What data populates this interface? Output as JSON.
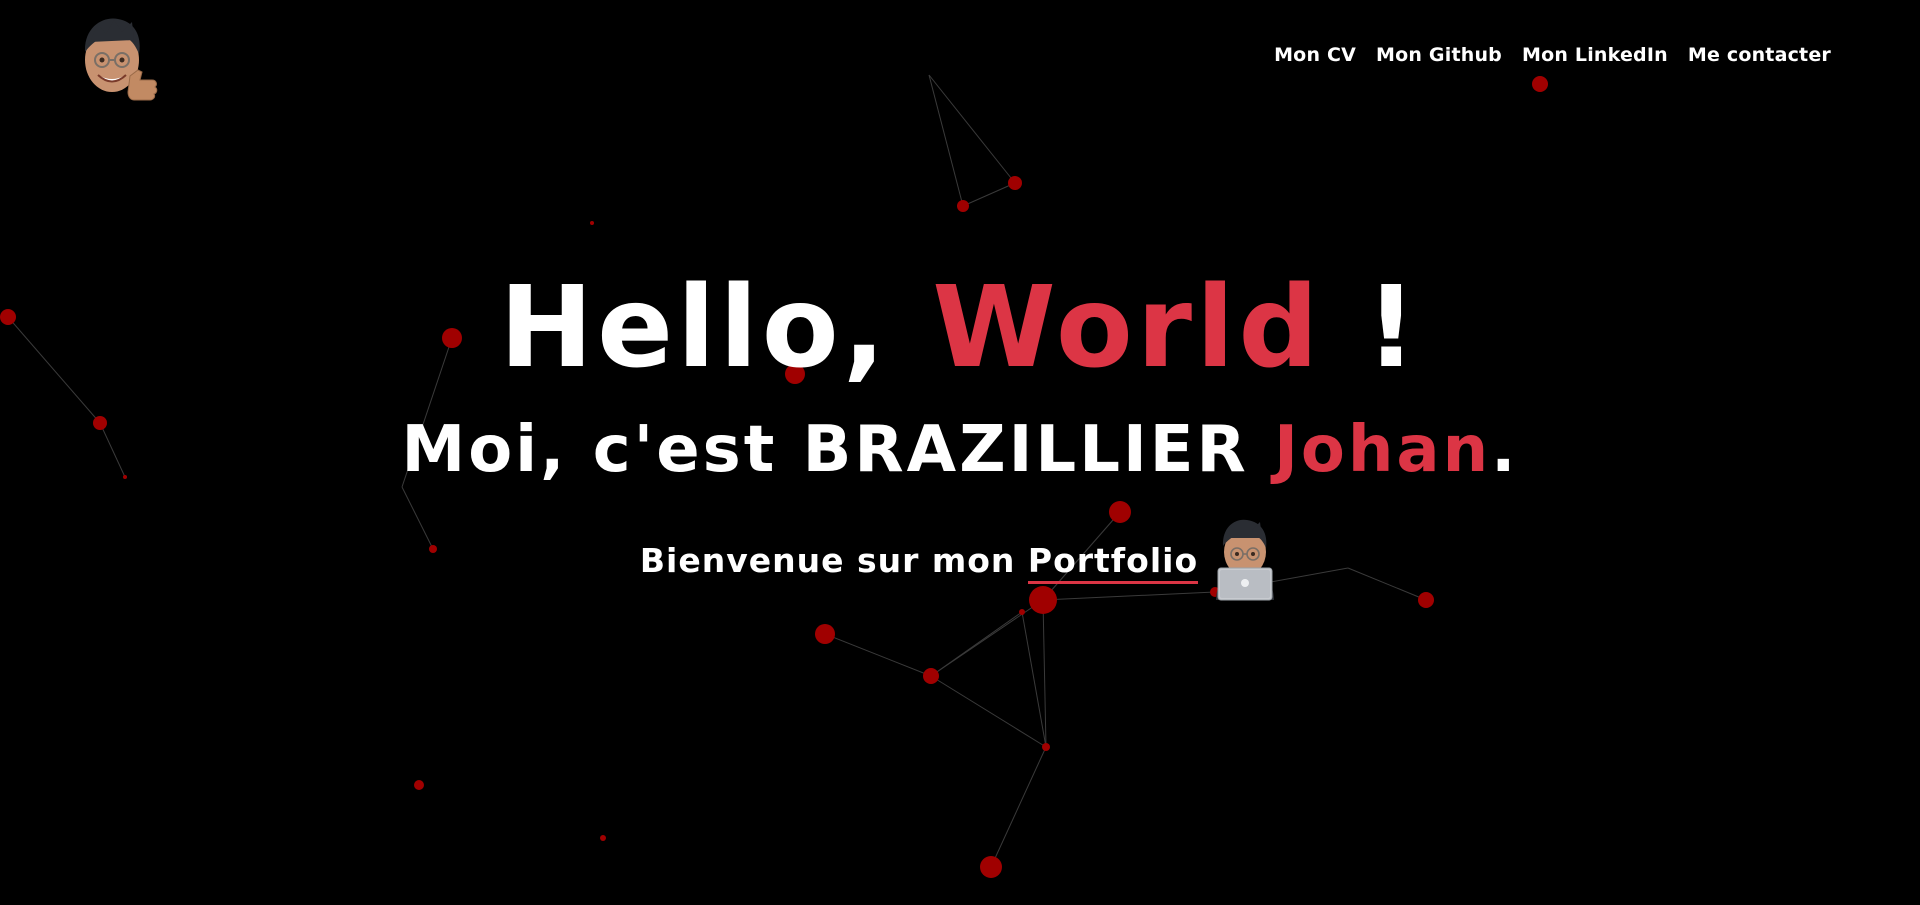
{
  "brand": {
    "avatar_icon": "memoji-thumbs-up-icon"
  },
  "nav": {
    "items": [
      {
        "label": "Mon CV"
      },
      {
        "label": "Mon Github"
      },
      {
        "label": "Mon LinkedIn"
      },
      {
        "label": "Me contacter"
      }
    ]
  },
  "hero": {
    "greeting_prefix": "Hello, ",
    "greeting_accent": "World",
    "greeting_suffix": " !",
    "intro_prefix": "Moi, c'est BRAZILLIER ",
    "intro_accent": "Johan",
    "intro_suffix": ".",
    "welcome_prefix": "Bienvenue sur mon ",
    "welcome_link": "Portfolio",
    "welcome_icon": "memoji-laptop-icon"
  },
  "colors": {
    "background": "#000000",
    "accent": "#dc3545",
    "particle": "#a00000",
    "link_line": "#3a3a3a"
  }
}
